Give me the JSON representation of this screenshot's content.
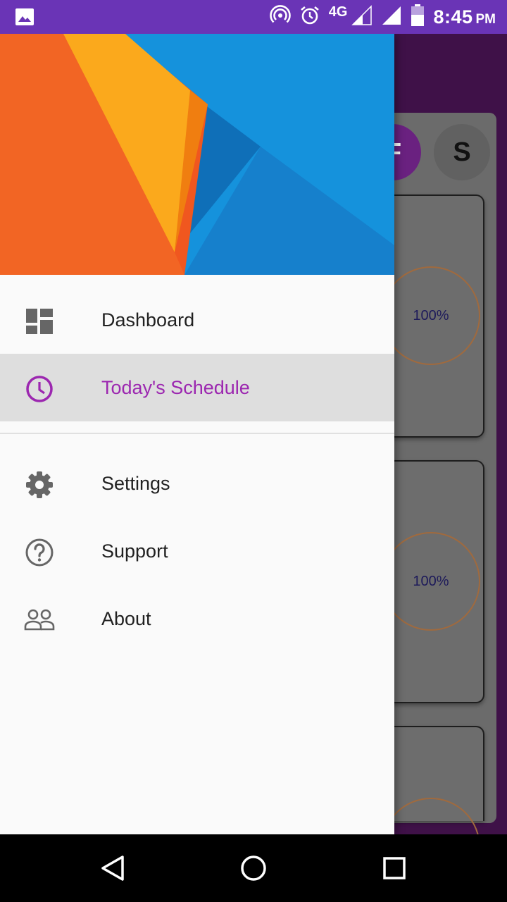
{
  "status_bar": {
    "network": "4G",
    "time": "8:45",
    "ampm": "PM",
    "icons": [
      "gallery-icon",
      "hotspot-icon",
      "alarm-icon",
      "signal-icon",
      "signal-icon",
      "battery-icon"
    ]
  },
  "background": {
    "avatar_f": "F",
    "avatar_s": "S",
    "cards": [
      {
        "percent": "100%"
      },
      {
        "percent": "100%"
      },
      {
        "percent": ""
      }
    ]
  },
  "drawer": {
    "menu": [
      {
        "label": "Dashboard",
        "icon": "dashboard-icon"
      },
      {
        "label": "Today's Schedule",
        "icon": "clock-icon",
        "active": true
      }
    ],
    "secondary_menu": [
      {
        "label": "Settings",
        "icon": "gear-icon"
      },
      {
        "label": "Support",
        "icon": "help-icon"
      },
      {
        "label": "About",
        "icon": "people-icon"
      }
    ]
  },
  "colors": {
    "status_bar": "#6a34b6",
    "accent": "#9c27b0",
    "active_row": "#dedede",
    "drawer_bg": "#fafafa"
  }
}
